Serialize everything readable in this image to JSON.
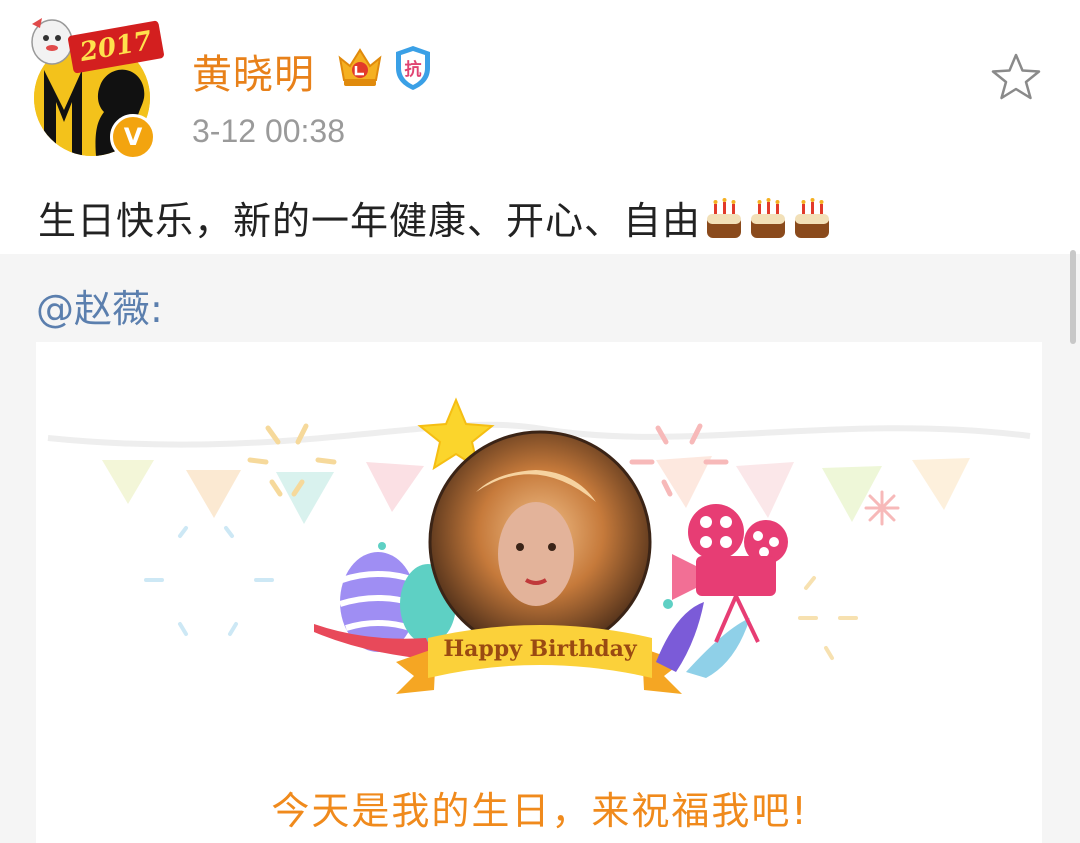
{
  "post": {
    "username": "黄晓明",
    "timestamp": "3-12 00:38",
    "avatar_year": "2017",
    "text": "生日快乐，新的一年健康、开心、自由",
    "cake_emoji_count": 3,
    "badges": [
      "crown-vip-icon",
      "shield-kang-icon"
    ],
    "shield_text": "抗",
    "verified_mark": "V"
  },
  "repost": {
    "mention": "@赵薇",
    "mention_suffix": ":",
    "card": {
      "banner_text": "Happy Birthday",
      "caption": "今天是我的生日，来祝福我吧!"
    }
  },
  "colors": {
    "username": "#e8811a",
    "mention": "#5b7fae",
    "caption": "#f08a1c",
    "repost_bg": "#f5f5f5"
  }
}
